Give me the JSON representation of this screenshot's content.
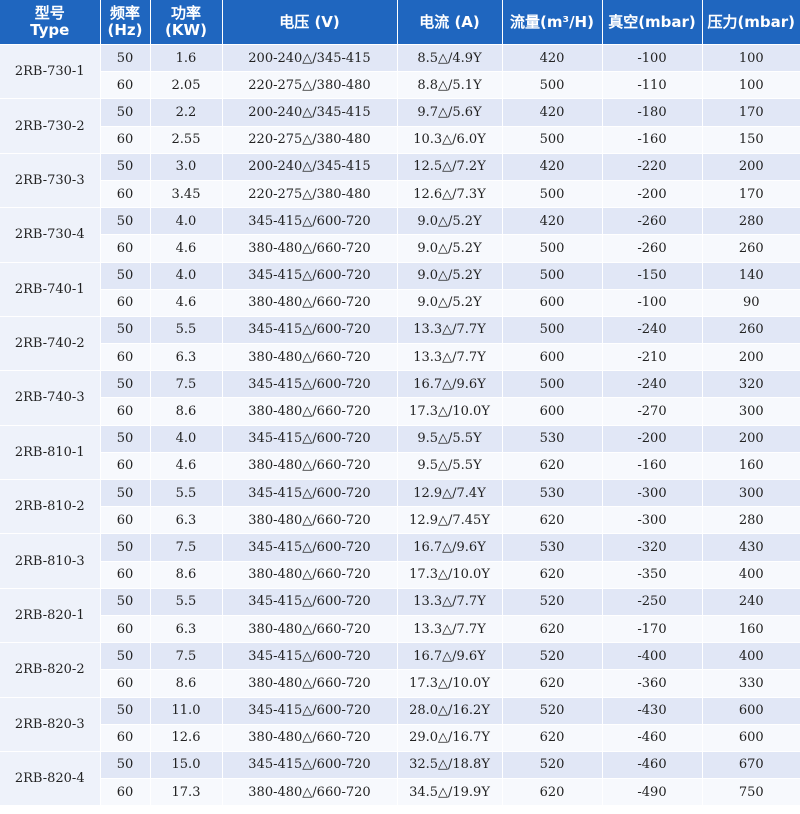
{
  "headers": [
    {
      "key": "model",
      "line1": "型号",
      "line2": "Type"
    },
    {
      "key": "freq",
      "line1": "频率",
      "line2": "(Hz)"
    },
    {
      "key": "power",
      "line1": "功率",
      "line2": "(KW)"
    },
    {
      "key": "voltage",
      "line1": "电压 (V)",
      "line2": ""
    },
    {
      "key": "current",
      "line1": "电流 (A)",
      "line2": ""
    },
    {
      "key": "flow",
      "line1": "流量(m³/H)",
      "line2": ""
    },
    {
      "key": "vacuum",
      "line1": "真空(mbar)",
      "line2": ""
    },
    {
      "key": "pressure",
      "line1": "压力(mbar)",
      "line2": ""
    }
  ],
  "models": [
    {
      "model": "2RB-730-1",
      "rows": [
        {
          "freq": "50",
          "power": "1.6",
          "voltage": "200-240△/345-415",
          "current": "8.5△/4.9Y",
          "flow": "420",
          "vacuum": "-100",
          "pressure": "100"
        },
        {
          "freq": "60",
          "power": "2.05",
          "voltage": "220-275△/380-480",
          "current": "8.8△/5.1Y",
          "flow": "500",
          "vacuum": "-110",
          "pressure": "100"
        }
      ]
    },
    {
      "model": "2RB-730-2",
      "rows": [
        {
          "freq": "50",
          "power": "2.2",
          "voltage": "200-240△/345-415",
          "current": "9.7△/5.6Y",
          "flow": "420",
          "vacuum": "-180",
          "pressure": "170"
        },
        {
          "freq": "60",
          "power": "2.55",
          "voltage": "220-275△/380-480",
          "current": "10.3△/6.0Y",
          "flow": "500",
          "vacuum": "-160",
          "pressure": "150"
        }
      ]
    },
    {
      "model": "2RB-730-3",
      "rows": [
        {
          "freq": "50",
          "power": "3.0",
          "voltage": "200-240△/345-415",
          "current": "12.5△/7.2Y",
          "flow": "420",
          "vacuum": "-220",
          "pressure": "200"
        },
        {
          "freq": "60",
          "power": "3.45",
          "voltage": "220-275△/380-480",
          "current": "12.6△/7.3Y",
          "flow": "500",
          "vacuum": "-200",
          "pressure": "170"
        }
      ]
    },
    {
      "model": "2RB-730-4",
      "rows": [
        {
          "freq": "50",
          "power": "4.0",
          "voltage": "345-415△/600-720",
          "current": "9.0△/5.2Y",
          "flow": "420",
          "vacuum": "-260",
          "pressure": "280"
        },
        {
          "freq": "60",
          "power": "4.6",
          "voltage": "380-480△/660-720",
          "current": "9.0△/5.2Y",
          "flow": "500",
          "vacuum": "-260",
          "pressure": "260"
        }
      ]
    },
    {
      "model": "2RB-740-1",
      "rows": [
        {
          "freq": "50",
          "power": "4.0",
          "voltage": "345-415△/600-720",
          "current": "9.0△/5.2Y",
          "flow": "500",
          "vacuum": "-150",
          "pressure": "140"
        },
        {
          "freq": "60",
          "power": "4.6",
          "voltage": "380-480△/660-720",
          "current": "9.0△/5.2Y",
          "flow": "600",
          "vacuum": "-100",
          "pressure": "90"
        }
      ]
    },
    {
      "model": "2RB-740-2",
      "rows": [
        {
          "freq": "50",
          "power": "5.5",
          "voltage": "345-415△/600-720",
          "current": "13.3△/7.7Y",
          "flow": "500",
          "vacuum": "-240",
          "pressure": "260"
        },
        {
          "freq": "60",
          "power": "6.3",
          "voltage": "380-480△/660-720",
          "current": "13.3△/7.7Y",
          "flow": "600",
          "vacuum": "-210",
          "pressure": "200"
        }
      ]
    },
    {
      "model": "2RB-740-3",
      "rows": [
        {
          "freq": "50",
          "power": "7.5",
          "voltage": "345-415△/600-720",
          "current": "16.7△/9.6Y",
          "flow": "500",
          "vacuum": "-240",
          "pressure": "320"
        },
        {
          "freq": "60",
          "power": "8.6",
          "voltage": "380-480△/660-720",
          "current": "17.3△/10.0Y",
          "flow": "600",
          "vacuum": "-270",
          "pressure": "300"
        }
      ]
    },
    {
      "model": "2RB-810-1",
      "rows": [
        {
          "freq": "50",
          "power": "4.0",
          "voltage": "345-415△/600-720",
          "current": "9.5△/5.5Y",
          "flow": "530",
          "vacuum": "-200",
          "pressure": "200"
        },
        {
          "freq": "60",
          "power": "4.6",
          "voltage": "380-480△/660-720",
          "current": "9.5△/5.5Y",
          "flow": "620",
          "vacuum": "-160",
          "pressure": "160"
        }
      ]
    },
    {
      "model": "2RB-810-2",
      "rows": [
        {
          "freq": "50",
          "power": "5.5",
          "voltage": "345-415△/600-720",
          "current": "12.9△/7.4Y",
          "flow": "530",
          "vacuum": "-300",
          "pressure": "300"
        },
        {
          "freq": "60",
          "power": "6.3",
          "voltage": "380-480△/660-720",
          "current": "12.9△/7.45Y",
          "flow": "620",
          "vacuum": "-300",
          "pressure": "280"
        }
      ]
    },
    {
      "model": "2RB-810-3",
      "rows": [
        {
          "freq": "50",
          "power": "7.5",
          "voltage": "345-415△/600-720",
          "current": "16.7△/9.6Y",
          "flow": "530",
          "vacuum": "-320",
          "pressure": "430"
        },
        {
          "freq": "60",
          "power": "8.6",
          "voltage": "380-480△/660-720",
          "current": "17.3△/10.0Y",
          "flow": "620",
          "vacuum": "-350",
          "pressure": "400"
        }
      ]
    },
    {
      "model": "2RB-820-1",
      "rows": [
        {
          "freq": "50",
          "power": "5.5",
          "voltage": "345-415△/600-720",
          "current": "13.3△/7.7Y",
          "flow": "520",
          "vacuum": "-250",
          "pressure": "240"
        },
        {
          "freq": "60",
          "power": "6.3",
          "voltage": "380-480△/660-720",
          "current": "13.3△/7.7Y",
          "flow": "620",
          "vacuum": "-170",
          "pressure": "160"
        }
      ]
    },
    {
      "model": "2RB-820-2",
      "rows": [
        {
          "freq": "50",
          "power": "7.5",
          "voltage": "345-415△/600-720",
          "current": "16.7△/9.6Y",
          "flow": "520",
          "vacuum": "-400",
          "pressure": "400"
        },
        {
          "freq": "60",
          "power": "8.6",
          "voltage": "380-480△/660-720",
          "current": "17.3△/10.0Y",
          "flow": "620",
          "vacuum": "-360",
          "pressure": "330"
        }
      ]
    },
    {
      "model": "2RB-820-3",
      "rows": [
        {
          "freq": "50",
          "power": "11.0",
          "voltage": "345-415△/600-720",
          "current": "28.0△/16.2Y",
          "flow": "520",
          "vacuum": "-430",
          "pressure": "600"
        },
        {
          "freq": "60",
          "power": "12.6",
          "voltage": "380-480△/660-720",
          "current": "29.0△/16.7Y",
          "flow": "620",
          "vacuum": "-460",
          "pressure": "600"
        }
      ]
    },
    {
      "model": "2RB-820-4",
      "rows": [
        {
          "freq": "50",
          "power": "15.0",
          "voltage": "345-415△/600-720",
          "current": "32.5△/18.8Y",
          "flow": "520",
          "vacuum": "-460",
          "pressure": "670"
        },
        {
          "freq": "60",
          "power": "17.3",
          "voltage": "380-480△/660-720",
          "current": "34.5△/19.9Y",
          "flow": "620",
          "vacuum": "-490",
          "pressure": "750"
        }
      ]
    }
  ],
  "colors": {
    "header_bg": "#1f66bf",
    "header_text": "#ffffff",
    "row_shade": "#e1e7f6",
    "row_plain": "#f7f9fd"
  }
}
